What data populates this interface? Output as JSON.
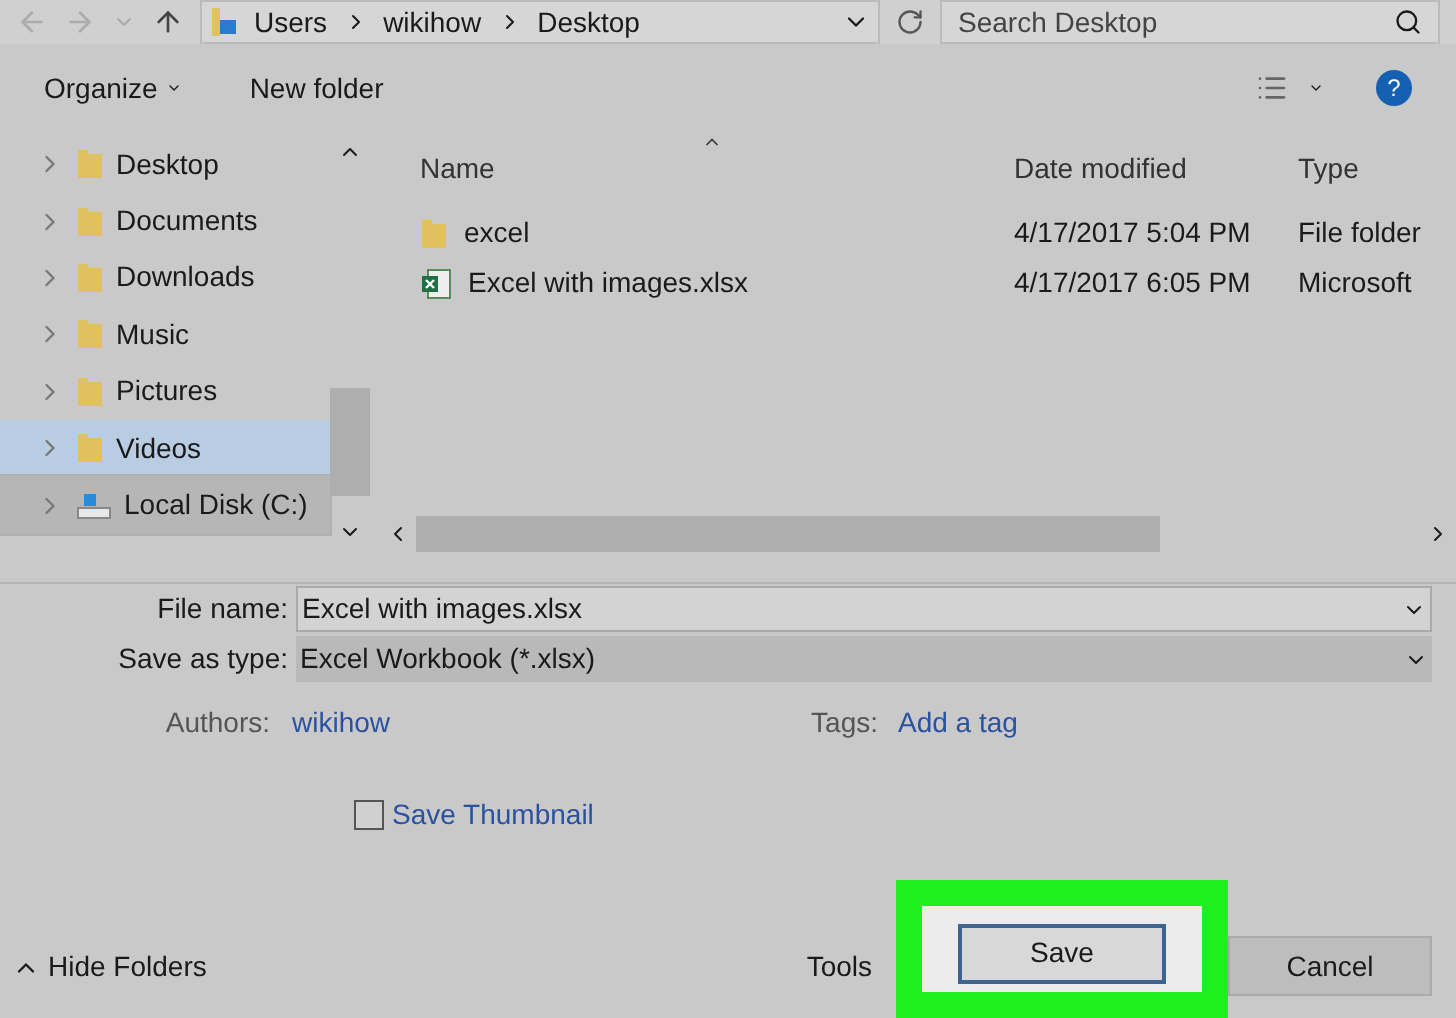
{
  "address_bar": {
    "path": [
      "Users",
      "wikihow",
      "Desktop"
    ]
  },
  "search": {
    "placeholder": "Search Desktop"
  },
  "toolbar": {
    "organize": "Organize",
    "new_folder": "New folder",
    "help": "?"
  },
  "sidebar": {
    "items": [
      {
        "label": "Desktop",
        "kind": "folder",
        "selected": false,
        "hovered": false
      },
      {
        "label": "Documents",
        "kind": "folder",
        "selected": false,
        "hovered": false
      },
      {
        "label": "Downloads",
        "kind": "folder",
        "selected": false,
        "hovered": false
      },
      {
        "label": "Music",
        "kind": "folder",
        "selected": false,
        "hovered": false
      },
      {
        "label": "Pictures",
        "kind": "folder",
        "selected": false,
        "hovered": false
      },
      {
        "label": "Videos",
        "kind": "folder",
        "selected": true,
        "hovered": false
      },
      {
        "label": "Local Disk (C:)",
        "kind": "drive",
        "selected": false,
        "hovered": true
      }
    ]
  },
  "table": {
    "columns": [
      "Name",
      "Date modified",
      "Type"
    ],
    "rows": [
      {
        "kind": "folder",
        "cells": [
          "excel",
          "4/17/2017 5:04 PM",
          "File folder"
        ]
      },
      {
        "kind": "excel",
        "cells": [
          "Excel with images.xlsx",
          "4/17/2017 6:05 PM",
          "Microsoft"
        ]
      }
    ]
  },
  "form": {
    "file_name_label": "File name:",
    "file_name": "Excel with images.xlsx",
    "type_label": "Save as type:",
    "type": "Excel Workbook (*.xlsx)",
    "authors_label": "Authors:",
    "authors": "wikihow",
    "tags_label": "Tags:",
    "tags": "Add a tag",
    "thumbnail": {
      "label": "Save Thumbnail",
      "checked": false
    }
  },
  "footer": {
    "hide_folders": "Hide Folders",
    "tools": "Tools",
    "save": "Save",
    "cancel": "Cancel",
    "save_highlighted": true
  }
}
